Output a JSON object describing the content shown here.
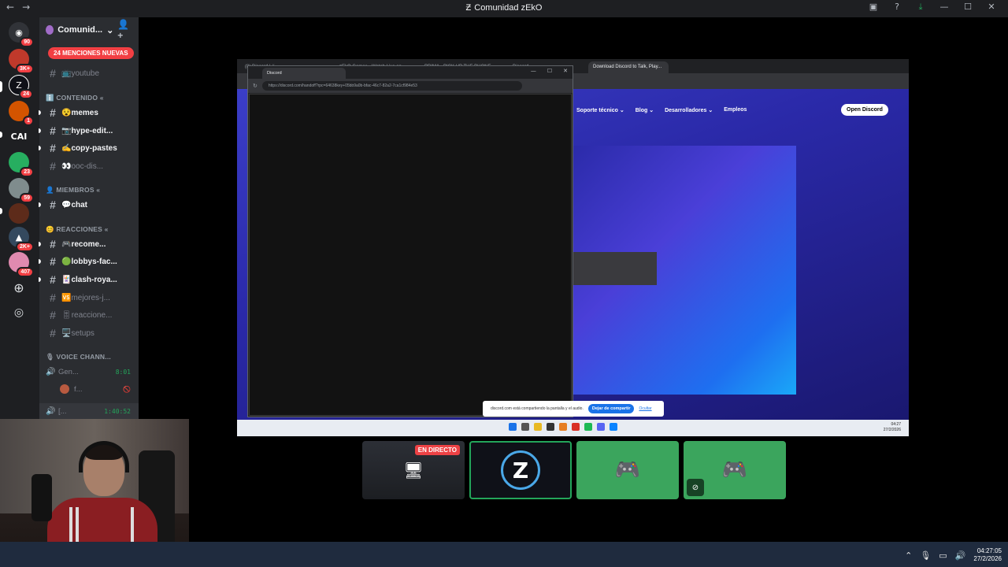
{
  "window": {
    "title": "Comunidad zEkO",
    "back": "←",
    "forward": "→",
    "controls": [
      "▣",
      "?",
      "⤓",
      "—",
      "☐",
      "✕"
    ]
  },
  "servers": [
    {
      "icon": "discord-home-icon",
      "glyph": "◉",
      "badge": "90",
      "color": "#5865f2"
    },
    {
      "icon": "server-avatar-1",
      "glyph": "",
      "badge": "3K+",
      "color": "#c0392b"
    },
    {
      "icon": "server-zeko",
      "glyph": "Z",
      "badge": "24",
      "color": "#0f1118"
    },
    {
      "icon": "server-avatar-3",
      "glyph": "",
      "badge": "1",
      "color": "#d35400"
    },
    {
      "icon": "server-cai",
      "glyph": "CAI",
      "badge": "",
      "color": "#1e1f22"
    },
    {
      "icon": "server-avatar-5",
      "glyph": "",
      "badge": "23",
      "color": "#27ae60"
    },
    {
      "icon": "server-avatar-6",
      "glyph": "",
      "badge": "59",
      "color": "#7f8c8d"
    },
    {
      "icon": "server-avatar-7",
      "glyph": "",
      "badge": "",
      "color": "#5d2b1a"
    },
    {
      "icon": "server-avatar-8",
      "glyph": "▲",
      "badge": "2K+",
      "color": "#34495e"
    },
    {
      "icon": "server-avatar-9",
      "glyph": "",
      "badge": "407",
      "color": "#e08ab0"
    }
  ],
  "guild": {
    "name": "Comunid...",
    "mentions_badge": "24 MENCIONES NUEVAS"
  },
  "channels": {
    "youtube": "📺youtube",
    "cat_contenido": "ℹ️ CONTENIDO «",
    "memes": "😵memes",
    "hype": "📷hype-edit...",
    "copy": "✍️copy-pastes",
    "ooc": "👀ooc-dis...",
    "cat_miembros": "👤 MIEMBROS «",
    "chat": "💬chat",
    "cat_reacciones": "😊 REACCIONES «",
    "recome": "🎮recome...",
    "lobbys": "🟢lobbys-fac...",
    "clash": "🃏clash-roya...",
    "mejores": "🆚mejores-j...",
    "reacciones": "🎚reaccione...",
    "setups": "🖥️setups",
    "cat_voice": "🎙 VOICE CHANN...",
    "gen": "Gen...",
    "gen_time": "8:01",
    "user_f": "f...",
    "live_ch": "[...",
    "live_time": "1:40:52"
  },
  "stream": {
    "tabs": [
      "(8) Discord | #...",
      "zEkO Games - Watch Live on...",
      "PRIMA - PICK UP THE PHONE...",
      "Discord",
      "Download Discord to Talk, Play..."
    ],
    "nav": [
      "Soporte técnico ⌄",
      "Blog ⌄",
      "Desarrolladores ⌄",
      "Empleos"
    ],
    "open_discord": "Open Discord",
    "popup_tab": "Discord",
    "popup_url": "https://discord.com/handoff?rpc=64638key+05bb9a0b-bfac-46c7-82a2-7ca1cf984e53",
    "share_text": "discord.com está compartiendo la pantalla y el audio.",
    "stop_share": "Dejar de compartir",
    "hide": "Ocultar",
    "win_lang": "ESP\nLAA",
    "win_time": "04:27",
    "win_date": "27/2/2026"
  },
  "tiles": {
    "live_label": "EN DIRECTO"
  },
  "taskbar": {
    "time": "04:27:05",
    "date": "27/2/2026"
  }
}
